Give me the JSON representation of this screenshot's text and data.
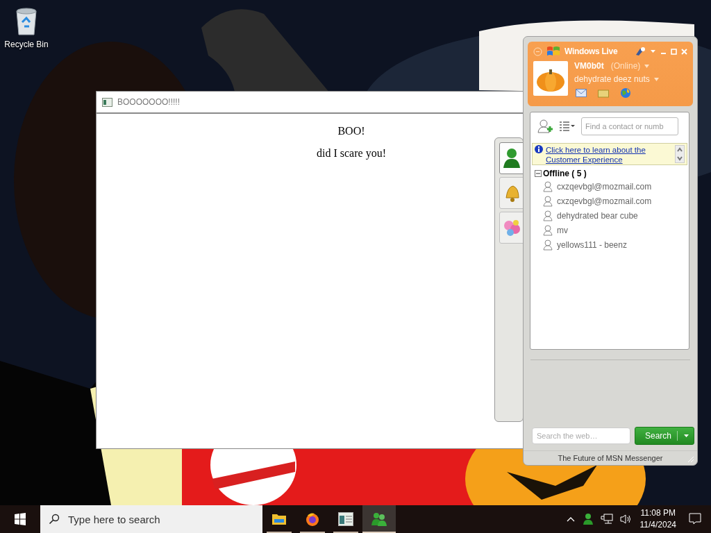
{
  "desktop": {
    "icons": [
      {
        "label": "Recycle Bin"
      }
    ]
  },
  "dialog": {
    "title": "BOOOOOOO!!!!!",
    "heading": "BOO!",
    "message": "did I scare you!",
    "side_tabs": [
      {
        "kind": "contacts",
        "selected": true
      },
      {
        "kind": "alerts",
        "selected": false
      },
      {
        "kind": "flowers",
        "selected": false
      }
    ]
  },
  "messenger": {
    "brand": "Windows Live",
    "user": {
      "name": "VM0b0t",
      "status": "(Online)",
      "message": "dehydrate deez nuts"
    },
    "find_placeholder": "Find a contact or numb",
    "banner": {
      "link": "Click here to learn about the Customer Experience"
    },
    "groups": [
      {
        "label": "Offline ( 5 )",
        "expanded": true,
        "contacts": [
          {
            "name": "cxzqevbgl@mozmail.com"
          },
          {
            "name": "cxzqevbgl@mozmail.com"
          },
          {
            "name": "dehydrated bear cube"
          },
          {
            "name": "mv"
          },
          {
            "name": "yellows111 - beenz"
          }
        ]
      }
    ],
    "web_search": {
      "placeholder": "Search the web…",
      "button": "Search"
    },
    "footer": "The Future of MSN Messenger"
  },
  "taskbar": {
    "search_placeholder": "Type here to search",
    "apps": [
      {
        "kind": "folder",
        "selected": false
      },
      {
        "kind": "browser",
        "selected": false
      },
      {
        "kind": "window",
        "selected": false
      },
      {
        "kind": "messenger",
        "selected": true
      }
    ],
    "clock": {
      "time": "11:08 PM",
      "date": "11/4/2024"
    }
  }
}
